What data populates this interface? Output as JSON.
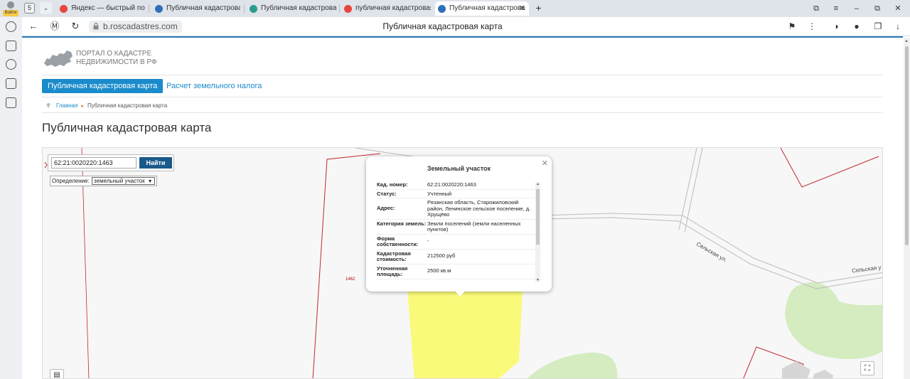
{
  "browser": {
    "profile_label": "Войти",
    "tab_count": "5",
    "tabs": [
      {
        "label": "Яндекс — быстрый поиск",
        "color": "#e8453c"
      },
      {
        "label": "Публичная кадастровая",
        "color": "#2f6fb8"
      },
      {
        "label": "Публичная кадастровая",
        "color": "#2a9d8f"
      },
      {
        "label": "публичная кадастровая",
        "color": "#e8453c"
      },
      {
        "label": "Публичная кадастрова",
        "color": "#2f6fb8"
      }
    ],
    "url": "b.roscadastres.com",
    "page_title": "Публичная кадастровая карта"
  },
  "site": {
    "logo_line1": "ПОРТАЛ О КАДАСТРЕ",
    "logo_line2": "НЕДВИЖИМОСТИ В РФ",
    "nav_active": "Публичная кадастровая карта",
    "nav_link": "Расчет земельного налога",
    "breadcrumb_home": "Главная",
    "breadcrumb_current": "Публичная кадастровая карта",
    "heading": "Публичная кадастровая карта"
  },
  "map": {
    "search_value": "62:21:0020220:1463",
    "search_button": "Найти",
    "definition_label": "Определение:",
    "definition_value": "земельный участок",
    "parcel_label": "1462",
    "street_1": "Сельская ул.",
    "street_2": "Сельская у"
  },
  "popup": {
    "title": "Земельный участок",
    "rows": [
      {
        "k": "Кад. номер:",
        "v": "62:21:0020220:1463"
      },
      {
        "k": "Статус:",
        "v": "Учтенный"
      },
      {
        "k": "Адрес:",
        "v": "Рязанская область, Старожиловский район, Ленинское сельское поселение, д. Хрущёво"
      },
      {
        "k": "Категория земель:",
        "v": "Земли поселений (земли населенных пунктов)"
      },
      {
        "k": "Форма собственности:",
        "v": "-"
      },
      {
        "k": "Кадастровая стоимость:",
        "v": "212500 руб"
      },
      {
        "k": "Уточненная площадь:",
        "v": "2500 кв.м"
      }
    ]
  },
  "colors": {
    "accent": "#1a8bcb",
    "parcel_fill": "#fafa7a",
    "boundary": "#c0282d",
    "green_area": "#d4ecc0"
  }
}
